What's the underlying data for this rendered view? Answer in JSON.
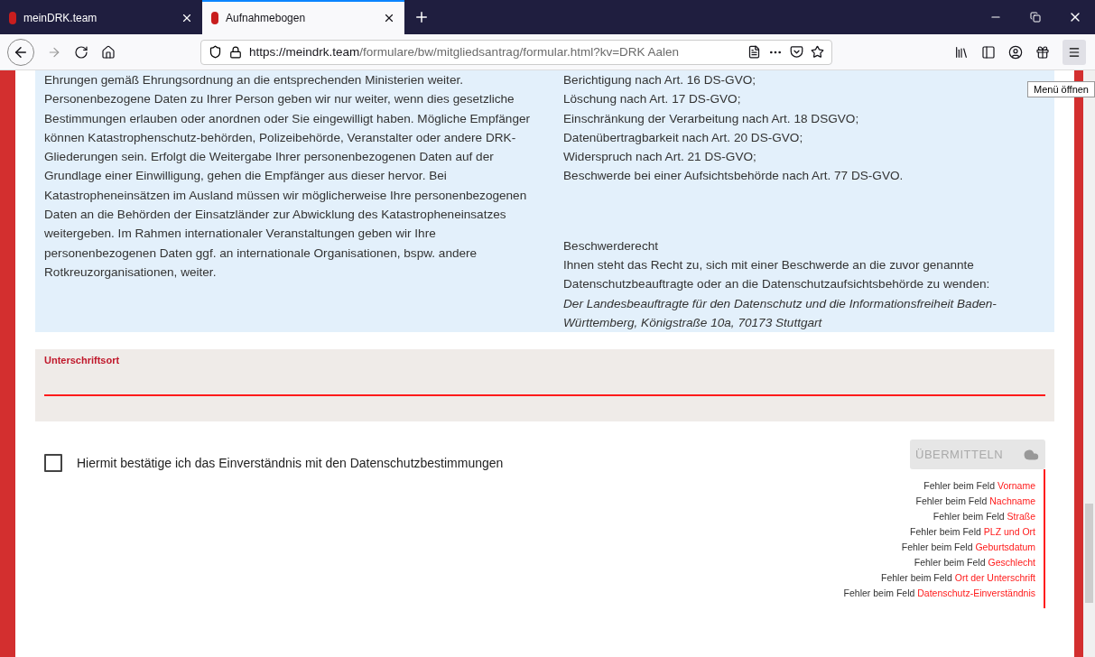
{
  "browser": {
    "tabs": [
      {
        "title": "meinDRK.team",
        "selected": false
      },
      {
        "title": "Aufnahmebogen",
        "selected": true
      }
    ],
    "url": {
      "host": "https://meindrk.team",
      "path": "/formulare/bw/mitgliedsantrag/formular.html?kv=DRK Aalen"
    },
    "tooltip": "Menü öffnen"
  },
  "info": {
    "left_paragraphs": [
      "Ehrungen gemäß Ehrungsordnung an die entsprechenden Ministerien weiter.",
      "Personenbezogene Daten zu Ihrer Person geben wir nur weiter, wenn dies gesetzliche Bestimmungen erlauben oder anordnen oder Sie eingewilligt haben. Mögliche Empfänger können Katastrophenschutz-behörden, Polizeibehörde, Veranstalter oder andere DRK-Gliederungen sein. Erfolgt die Weitergabe Ihrer personenbezogenen Daten auf der Grundlage einer Einwilligung, gehen die Empfänger aus dieser hervor. Bei Katastropheneinsätzen im Ausland müssen wir möglicherweise Ihre personenbezogenen Daten an die Behörden der Einsatzländer zur Abwicklung des Katastropheneinsatzes weitergeben. Im Rahmen internationaler Veranstaltungen geben wir Ihre personenbezogenen Daten ggf. an internationale Organisationen, bspw. andere Rotkreuzorganisationen, weiter."
    ],
    "rights": [
      "Berichtigung nach Art. 16 DS-GVO;",
      "Löschung nach Art. 17 DS-GVO;",
      "Einschränkung der Verarbeitung nach Art. 18 DSGVO;",
      "Datenübertragbarkeit nach Art. 20 DS-GVO;",
      "Widerspruch nach Art. 21 DS-GVO;",
      "Beschwerde bei einer Aufsichtsbehörde nach Art. 77 DS-GVO."
    ],
    "complaint_heading": "Beschwerderecht",
    "complaint_text": "Ihnen steht das Recht zu, sich mit einer Beschwerde an die zuvor genannte Datenschutzbeauftragte oder an die Datenschutzaufsichtsbehörde zu wenden:",
    "complaint_address": "Der Landesbeauftragte für den Datenschutz und die Informationsfreiheit Baden-Württemberg, Königstraße 10a, 70173 Stuttgart"
  },
  "signature_field": {
    "label": "Unterschriftsort",
    "error": true
  },
  "consent": {
    "label": "Hiermit bestätige ich das Einverständnis mit den Datenschutzbestimmungen",
    "checked": false
  },
  "submit": {
    "label": "ÜBERMITTELN",
    "disabled": true
  },
  "errors": [
    {
      "prefix": "Fehler beim Feld",
      "field": "Vorname"
    },
    {
      "prefix": "Fehler beim Feld",
      "field": "Nachname"
    },
    {
      "prefix": "Fehler beim Feld",
      "field": "Straße"
    },
    {
      "prefix": "Fehler beim Feld",
      "field": "PLZ und Ort"
    },
    {
      "prefix": "Fehler beim Feld",
      "field": "Geburtsdatum"
    },
    {
      "prefix": "Fehler beim Feld",
      "field": "Geschlecht"
    },
    {
      "prefix": "Fehler beim Feld",
      "field": "Ort der Unterschrift"
    },
    {
      "prefix": "Fehler beim Feld",
      "field": "Datenschutz-Einverständnis"
    }
  ]
}
